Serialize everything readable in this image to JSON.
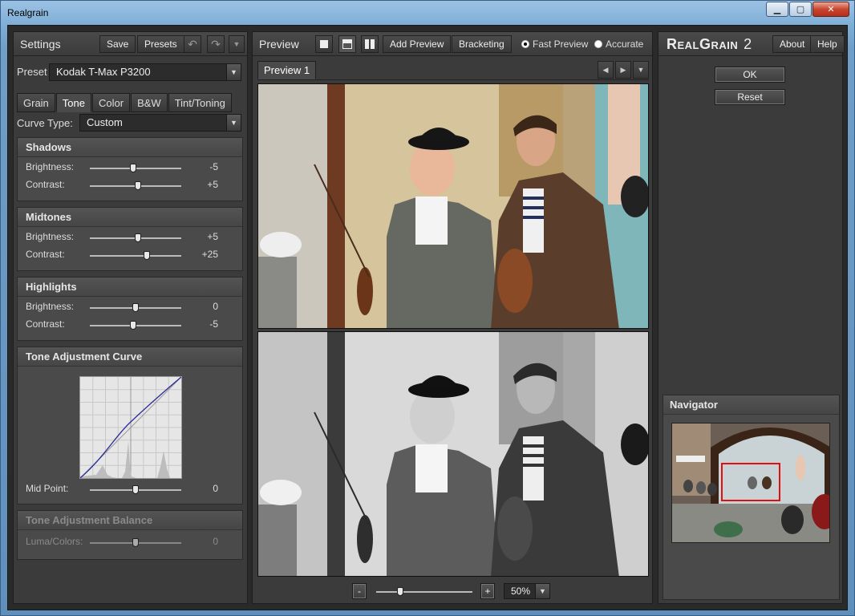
{
  "window": {
    "title": "Realgrain"
  },
  "settings": {
    "title": "Settings",
    "save_label": "Save",
    "presets_label": "Presets",
    "preset_label": "Preset",
    "preset_value": "Kodak T-Max P3200",
    "tabs": [
      {
        "label": "Grain",
        "active": false
      },
      {
        "label": "Tone",
        "active": true
      },
      {
        "label": "Color",
        "active": false
      },
      {
        "label": "B&W",
        "active": false
      },
      {
        "label": "Tint/Toning",
        "active": false
      }
    ],
    "curve_type_label": "Curve Type:",
    "curve_type_value": "Custom",
    "shadows": {
      "title": "Shadows",
      "brightness_label": "Brightness:",
      "brightness_value": "-5",
      "brightness_level": -5,
      "contrast_label": "Contrast:",
      "contrast_value": "+5",
      "contrast_level": 5
    },
    "midtones": {
      "title": "Midtones",
      "brightness_label": "Brightness:",
      "brightness_value": "+5",
      "brightness_level": 5,
      "contrast_label": "Contrast:",
      "contrast_value": "+25",
      "contrast_level": 25
    },
    "highlights": {
      "title": "Highlights",
      "brightness_label": "Brightness:",
      "brightness_value": "0",
      "brightness_level": 0,
      "contrast_label": "Contrast:",
      "contrast_value": "-5",
      "contrast_level": -5
    },
    "curve": {
      "title": "Tone Adjustment Curve",
      "midpoint_label": "Mid Point:",
      "midpoint_value": "0",
      "midpoint_level": 0
    },
    "balance": {
      "title": "Tone Adjustment Balance",
      "luma_label": "Luma/Colors:",
      "luma_value": "0",
      "luma_level": 0
    }
  },
  "preview": {
    "title": "Preview",
    "add_preview_label": "Add Preview",
    "bracketing_label": "Bracketing",
    "fast_preview_label": "Fast Preview",
    "accurate_label": "Accurate",
    "fast_preview_selected": true,
    "tab_label": "Preview 1",
    "zoom_minus": "-",
    "zoom_plus": "+",
    "zoom_value": "50%",
    "zoom_level": 0.25
  },
  "brand": {
    "name_big_r": "R",
    "name_rest1": "EAL",
    "name_big_g": "G",
    "name_rest2": "RAIN",
    "version": "2",
    "about_label": "About",
    "help_label": "Help",
    "ok_label": "OK",
    "reset_label": "Reset"
  },
  "navigator": {
    "title": "Navigator"
  },
  "colors": {
    "accent_curve": "#2a2a9a",
    "nav_box": "#e01010"
  }
}
